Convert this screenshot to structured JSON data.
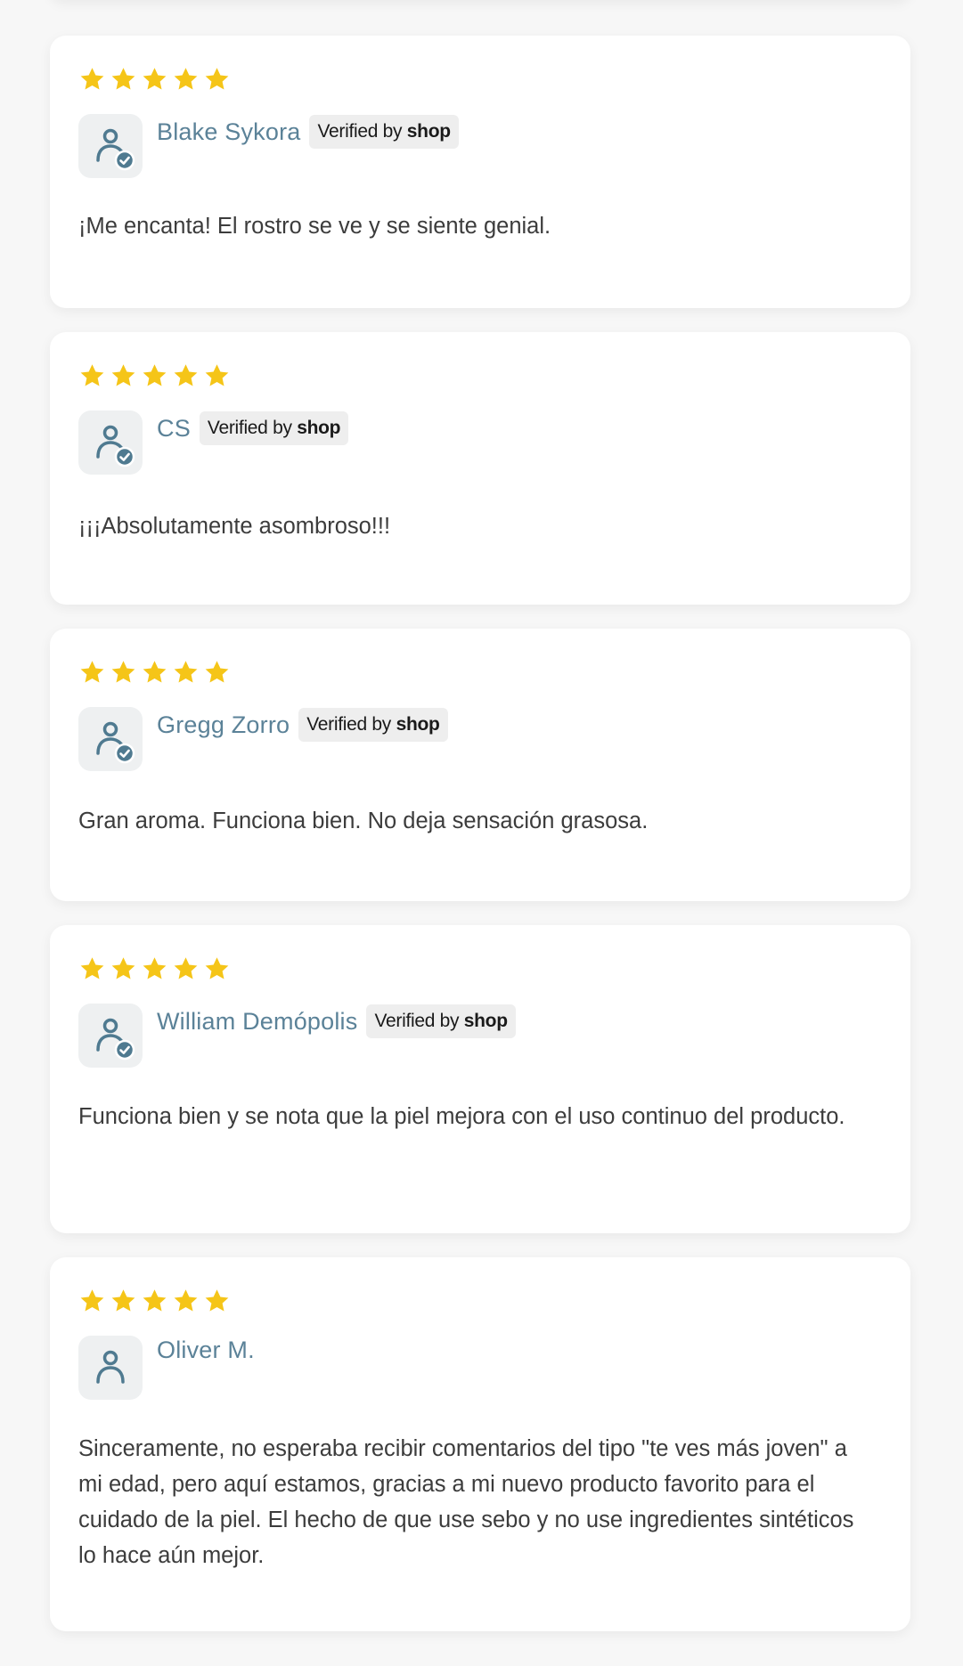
{
  "colors": {
    "star": "#f5c518",
    "name": "#5b8298",
    "avatar_icon": "#4f7a90",
    "badge_bg": "#eeeeee"
  },
  "icons": {
    "star": "star-icon",
    "avatar": "user-icon",
    "verified": "check-circle-icon"
  },
  "reviews": [
    {
      "rating": 5,
      "name": "Blake Sykora",
      "verified": true,
      "badge_prefix": "Verified by",
      "badge_shop": "shop",
      "text": "¡Me encanta! El rostro se ve y se siente genial."
    },
    {
      "rating": 5,
      "name": "CS",
      "verified": true,
      "badge_prefix": "Verified by",
      "badge_shop": "shop",
      "text": "¡¡¡Absolutamente asombroso!!!"
    },
    {
      "rating": 5,
      "name": "Gregg Zorro",
      "verified": true,
      "badge_prefix": "Verified by",
      "badge_shop": "shop",
      "text": "Gran aroma. Funciona bien. No deja sensación grasosa."
    },
    {
      "rating": 5,
      "name": "William Demópolis",
      "verified": true,
      "badge_prefix": "Verified by",
      "badge_shop": "shop",
      "text": "Funciona bien y se nota que la piel mejora con el uso continuo del producto."
    },
    {
      "rating": 5,
      "name": "Oliver M.",
      "verified": false,
      "text": "Sinceramente, no esperaba recibir comentarios del tipo \"te ves más joven\" a mi edad, pero aquí estamos, gracias a mi nuevo producto favorito para el cuidado de la piel. El hecho de que use sebo y no use ingredientes sintéticos lo hace aún mejor."
    }
  ]
}
